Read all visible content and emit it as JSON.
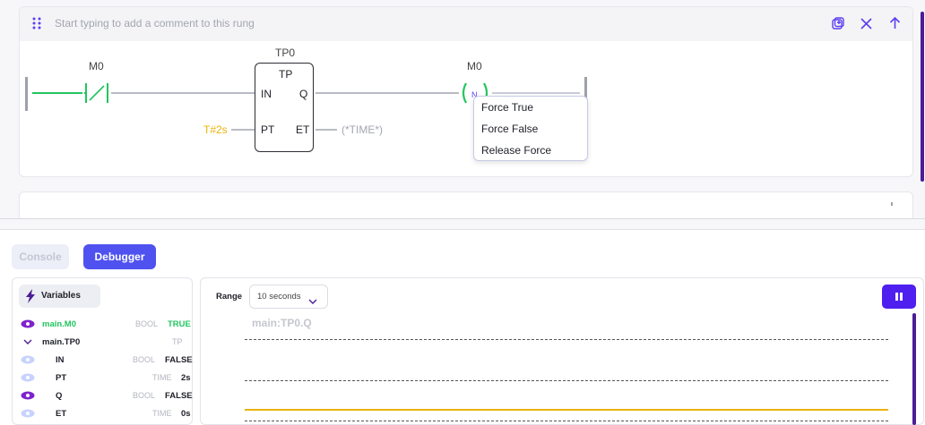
{
  "rung": {
    "comment_placeholder": "Start typing to add a comment to this rung",
    "contact_label": "M0",
    "coil_label": "M0",
    "coil_symbol": "N",
    "block": {
      "instance": "TP0",
      "type": "TP",
      "in": "IN",
      "q": "Q",
      "pt": "PT",
      "et": "ET",
      "pt_value": "T#2s",
      "et_value": "(*TIME*)"
    },
    "context_menu": [
      "Force True",
      "Force False",
      "Release Force"
    ]
  },
  "panel": {
    "tabs": {
      "console": "Console",
      "debugger": "Debugger"
    },
    "variables_label": "Variables",
    "variables": [
      {
        "name": "main.M0",
        "type": "BOOL",
        "value": "TRUE",
        "icon": "eye-icon"
      },
      {
        "name": "main.TP0",
        "type": "TP",
        "value": "",
        "icon": "chevron-down-icon"
      },
      {
        "name": "IN",
        "type": "BOOL",
        "value": "FALSE",
        "icon": "eye-icon"
      },
      {
        "name": "PT",
        "type": "TIME",
        "value": "2s",
        "icon": "eye-icon"
      },
      {
        "name": "Q",
        "type": "BOOL",
        "value": "FALSE",
        "icon": "eye-icon"
      },
      {
        "name": "ET",
        "type": "TIME",
        "value": "0s",
        "icon": "eye-icon"
      }
    ],
    "range_label": "Range",
    "range_value": "10 seconds",
    "graph_title": "main:TP0.Q"
  },
  "colors": {
    "accent": "#5b3ff0",
    "green": "#22c55e",
    "yellow": "#eab308"
  }
}
